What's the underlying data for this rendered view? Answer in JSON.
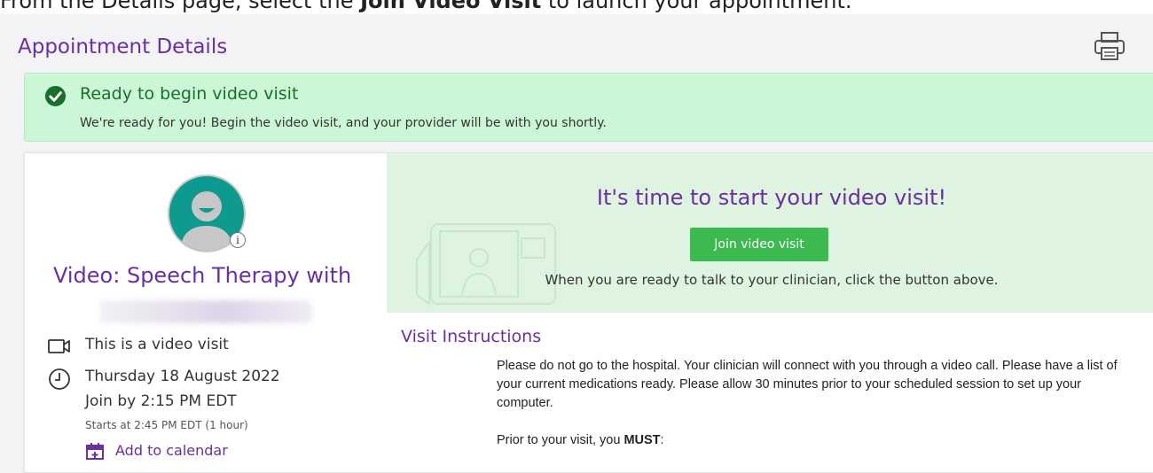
{
  "caption": {
    "prefix": "From the Details page, select the ",
    "bold": "Join Video Visit",
    "suffix": " to launch your appointment."
  },
  "page_title": "Appointment Details",
  "banner": {
    "title": "Ready to begin video visit",
    "subtitle": "We're ready for you! Begin the video visit, and your provider will be with you shortly."
  },
  "appointment": {
    "title": "Video: Speech Therapy with",
    "video_visit_label": "This is a video visit",
    "date": "Thursday 18 August 2022",
    "join_by": "Join by 2:15 PM EDT",
    "starts": "Starts at 2:45 PM EDT (1 hour)",
    "add_to_calendar": "Add to calendar",
    "info_glyph": "i"
  },
  "cta": {
    "title": "It's time to start your video visit!",
    "button": "Join video visit",
    "subtitle": "When you are ready to talk to your clinician, click the button above."
  },
  "instructions": {
    "title": "Visit Instructions",
    "paragraph1": "Please do not go to the hospital.  Your clinician will connect with you through a video call. Please have a list of your current medications ready. Please allow 30 minutes prior to your scheduled session to set up your computer.",
    "paragraph2_prefix": "Prior to your visit, you ",
    "paragraph2_bold": "MUST",
    "paragraph2_suffix": ":"
  },
  "colors": {
    "accent_purple": "#6b2fa1",
    "success_green": "#3cb94f",
    "banner_bg": "#ccf7d6",
    "cta_bg": "#def4e1",
    "avatar_teal": "#0e9a8e"
  },
  "icons": [
    "print-icon",
    "check-circle-icon",
    "user-avatar-icon",
    "info-icon",
    "video-camera-icon",
    "clock-icon",
    "calendar-icon"
  ]
}
